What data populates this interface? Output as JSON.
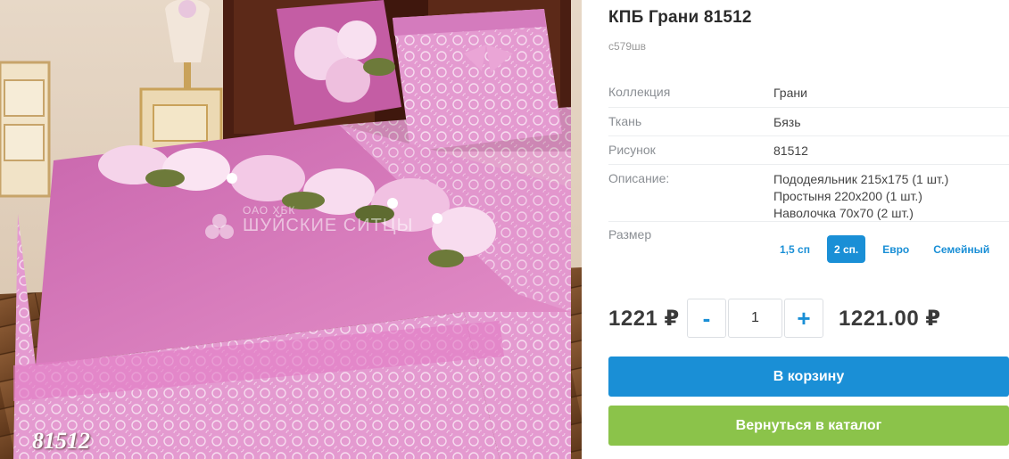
{
  "product": {
    "title": "КПБ Грани 81512",
    "sku": "c579шв",
    "image": {
      "caption": "81512",
      "watermark_line1": "ОАО ХБК",
      "watermark_line2": "ШУЙСКИЕ СИТЦЫ"
    }
  },
  "properties": {
    "collection": {
      "label": "Коллекция",
      "value": "Грани"
    },
    "fabric": {
      "label": "Ткань",
      "value": "Бязь"
    },
    "pattern": {
      "label": "Рисунок",
      "value": "81512"
    },
    "description": {
      "label": "Описание:",
      "lines": [
        "Пододеяльник 215x175 (1 шт.)",
        "Простыня 220x200 (1 шт.)",
        "Наволочка 70x70 (2 шт.)"
      ]
    },
    "size": {
      "label": "Размер",
      "options": [
        "1,5 сп",
        "2 сп.",
        "Евро",
        "Семейный"
      ],
      "selected": "2 сп."
    }
  },
  "purchase": {
    "price": "1221 ₽",
    "minus_label": "-",
    "plus_label": "+",
    "quantity": "1",
    "total": "1221.00 ₽"
  },
  "buttons": {
    "cart": "В корзину",
    "back": "Вернуться в каталог"
  },
  "colors": {
    "accent_blue": "#1a8fd6",
    "accent_green": "#8bc34a",
    "bedding_pink": "#d77fc0"
  }
}
